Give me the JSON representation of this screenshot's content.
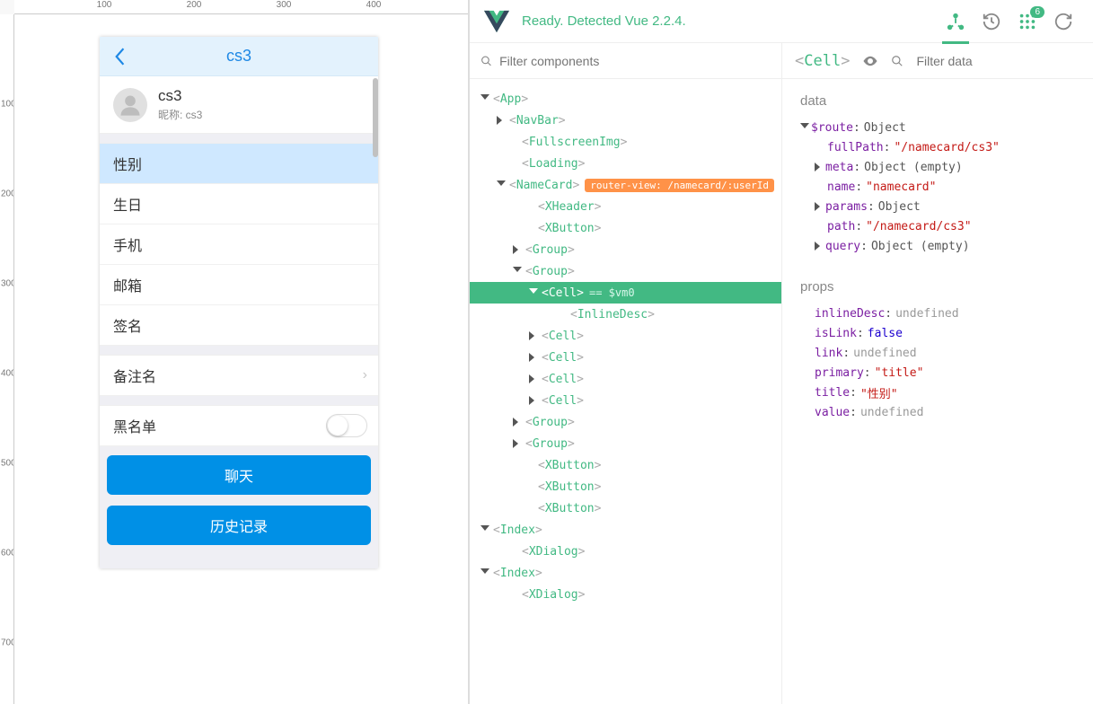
{
  "phone": {
    "title": "cs3",
    "profile": {
      "name": "cs3",
      "nickname_label": "昵称: cs3"
    },
    "cells": [
      "性别",
      "生日",
      "手机",
      "邮箱",
      "签名"
    ],
    "remark_cell": "备注名",
    "blacklist_cell": "黑名单",
    "buttons": {
      "chat": "聊天",
      "history": "历史记录"
    }
  },
  "devtools": {
    "status": "Ready. Detected Vue 2.2.4.",
    "badge_count": "6",
    "filter_components_placeholder": "Filter components",
    "filter_data_placeholder": "Filter data",
    "selected_component": "Cell",
    "router_badge": "router-view: /namecard/:userId",
    "vm_ref": "== $vm0",
    "tree": {
      "app": "App",
      "navbar": "NavBar",
      "fullscreen": "FullscreenImg",
      "loading": "Loading",
      "namecard": "NameCard",
      "xheader": "XHeader",
      "xbutton": "XButton",
      "group": "Group",
      "cell": "Cell",
      "inlinedesc": "InlineDesc",
      "index": "Index",
      "xdialog": "XDialog"
    },
    "data_section": {
      "label": "data",
      "route_key": "$route",
      "route_type": "Object",
      "fullPath_key": "fullPath",
      "fullPath_val": "\"/namecard/cs3\"",
      "meta_key": "meta",
      "meta_val": "Object (empty)",
      "name_key": "name",
      "name_val": "\"namecard\"",
      "params_key": "params",
      "params_val": "Object",
      "path_key": "path",
      "path_val": "\"/namecard/cs3\"",
      "query_key": "query",
      "query_val": "Object (empty)"
    },
    "props_section": {
      "label": "props",
      "inlineDesc_key": "inlineDesc",
      "inlineDesc_val": "undefined",
      "isLink_key": "isLink",
      "isLink_val": "false",
      "link_key": "link",
      "link_val": "undefined",
      "primary_key": "primary",
      "primary_val": "\"title\"",
      "title_key": "title",
      "title_val": "\"性别\"",
      "value_key": "value",
      "value_val": "undefined"
    }
  },
  "ruler_marks": [
    "100",
    "200",
    "300",
    "400"
  ],
  "ruler_marks_v": [
    "100",
    "200",
    "300",
    "400",
    "500",
    "600",
    "700"
  ]
}
